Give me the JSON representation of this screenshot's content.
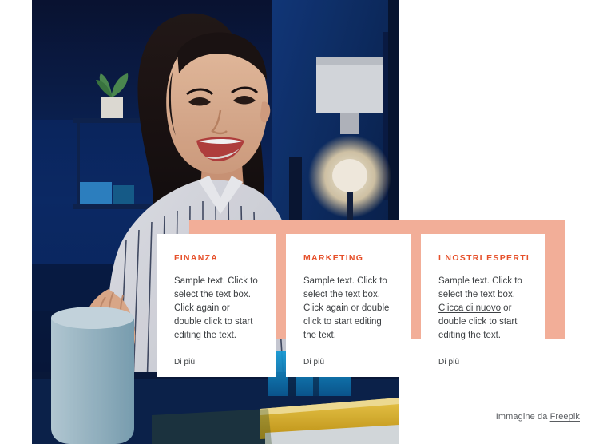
{
  "theme": {
    "peach": "#f2ae98",
    "accent": "#e6502a",
    "text": "#3d4043",
    "background": "#ffffff"
  },
  "hero": {
    "image_alt": "Smiling young woman in striped shirt at an office desk with blue ambient lighting"
  },
  "cards": [
    {
      "title": "FINANZA",
      "body_before": "Sample text. Click to select the text box. Click again or double click to start editing the text.",
      "link_text": "",
      "body_after": "",
      "more_label": "Di più"
    },
    {
      "title": "MARKETING",
      "body_before": "Sample text. Click to select the text box. Click again or double click to start editing the text.",
      "link_text": "",
      "body_after": "",
      "more_label": "Di più"
    },
    {
      "title": "I NOSTRI ESPERTI",
      "body_before": "Sample text. Click to select the text box. ",
      "link_text": "Clicca di nuovo",
      "body_after": " or double click to start editing the text.",
      "more_label": "Di più"
    }
  ],
  "credit": {
    "prefix": "Immagine da ",
    "link_label": "Freepik"
  }
}
